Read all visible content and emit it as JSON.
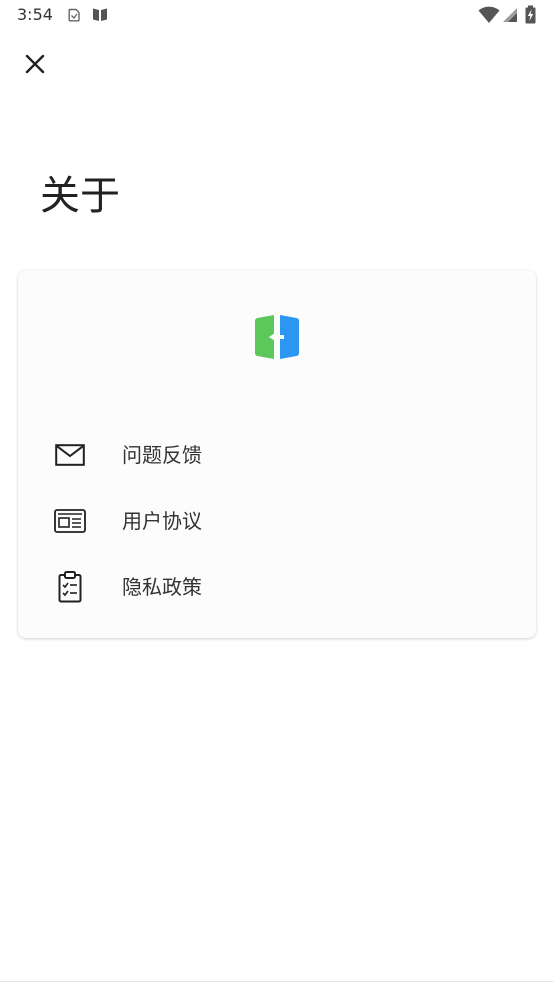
{
  "status_bar": {
    "time": "3:54",
    "icons": [
      "notification-save-icon",
      "app-notification-icon",
      "wifi-icon",
      "signal-icon",
      "battery-charging-icon"
    ]
  },
  "toolbar": {
    "close_icon": "close-icon"
  },
  "page": {
    "title": "关于"
  },
  "card": {
    "logo_icon": "app-logo-icon",
    "logo_colors": {
      "left": "#5cc85c",
      "right": "#2b97f2"
    },
    "items": [
      {
        "label": "问题反馈",
        "icon": "mail-icon"
      },
      {
        "label": "用户协议",
        "icon": "newspaper-icon"
      },
      {
        "label": "隐私政策",
        "icon": "clipboard-check-icon"
      }
    ]
  }
}
